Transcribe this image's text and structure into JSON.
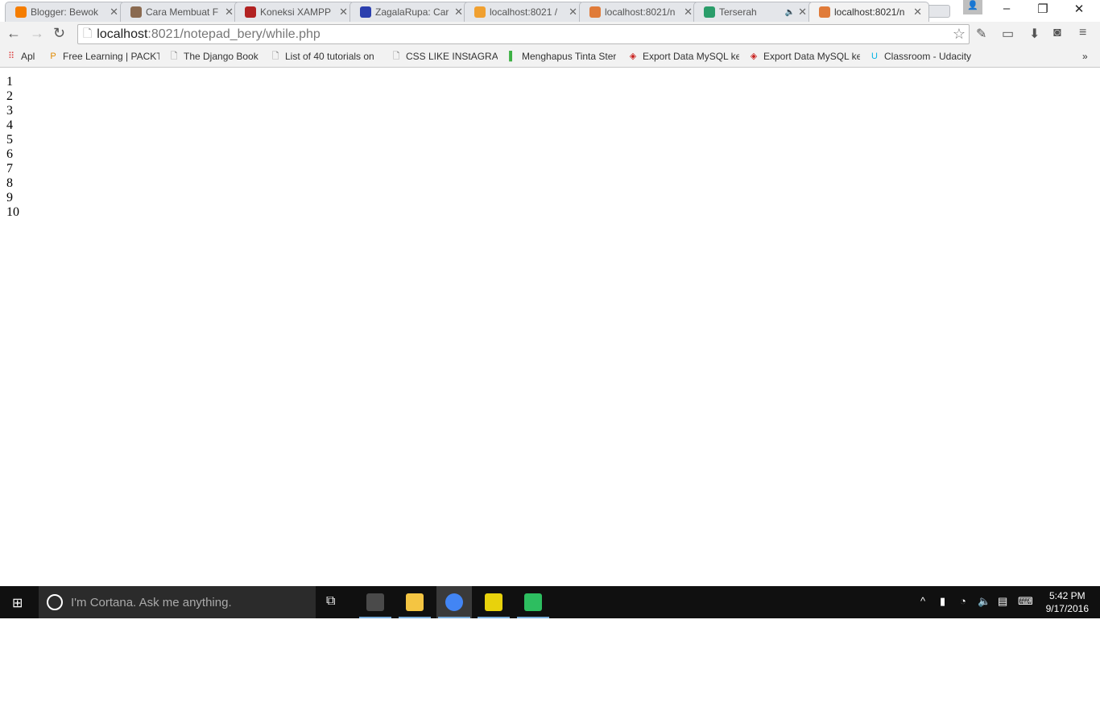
{
  "browser": {
    "tabs": [
      {
        "title": "Blogger: Bewok",
        "icon": "blogger-icon",
        "color": "#f57d00",
        "active": false
      },
      {
        "title": "Cara Membuat F",
        "icon": "avatar-icon",
        "color": "#8a6a50",
        "active": false
      },
      {
        "title": "Koneksi XAMPP",
        "icon": "konoha-icon",
        "color": "#b22222",
        "active": false
      },
      {
        "title": "ZagalaRupa: Car",
        "icon": "z-logo-icon",
        "color": "#2b3fae",
        "active": false
      },
      {
        "title": "localhost:8021 /",
        "icon": "phpmyadmin-icon",
        "color": "#f0a030",
        "active": false
      },
      {
        "title": "localhost:8021/n",
        "icon": "xampp-icon",
        "color": "#e07b39",
        "active": false
      },
      {
        "title": "Terserah",
        "icon": "music-icon",
        "color": "#2a9d6a",
        "active": false,
        "audio": true
      },
      {
        "title": "localhost:8021/n",
        "icon": "xampp-icon",
        "color": "#e07b39",
        "active": true
      }
    ],
    "url_host": "localhost",
    "url_path": ":8021/notepad_bery/while.php",
    "bookmarks": [
      {
        "label": "Apl",
        "icon": "apps-grid-icon"
      },
      {
        "label": "Free Learning | PACKT",
        "icon": "packt-icon"
      },
      {
        "label": "The Django Book",
        "icon": "page-icon"
      },
      {
        "label": "List of 40 tutorials on",
        "icon": "page-icon"
      },
      {
        "label": "CSS LIKE INStAGRAM",
        "icon": "page-icon"
      },
      {
        "label": "Menghapus Tinta Ster",
        "icon": "green-bookmark-icon"
      },
      {
        "label": "Export Data MySQL ke",
        "icon": "red-diamond-icon"
      },
      {
        "label": "Export Data MySQL ke",
        "icon": "red-diamond-icon"
      },
      {
        "label": "Classroom - Udacity",
        "icon": "udacity-icon"
      }
    ],
    "overflow": "»"
  },
  "page": {
    "lines": [
      "1",
      "2",
      "3",
      "4",
      "5",
      "6",
      "7",
      "8",
      "9",
      "10"
    ]
  },
  "taskbar": {
    "cortana_placeholder": "I'm Cortana. Ask me anything.",
    "apps": [
      {
        "name": "sublime-text",
        "color": "#4a4a4a"
      },
      {
        "name": "file-explorer",
        "color": "#f4c542"
      },
      {
        "name": "chrome",
        "color": "#4285f4"
      },
      {
        "name": "pdf-reader",
        "color": "#e8d20c"
      },
      {
        "name": "evernote",
        "color": "#2dbe60"
      }
    ],
    "time": "5:42 PM",
    "date": "9/17/2016"
  }
}
